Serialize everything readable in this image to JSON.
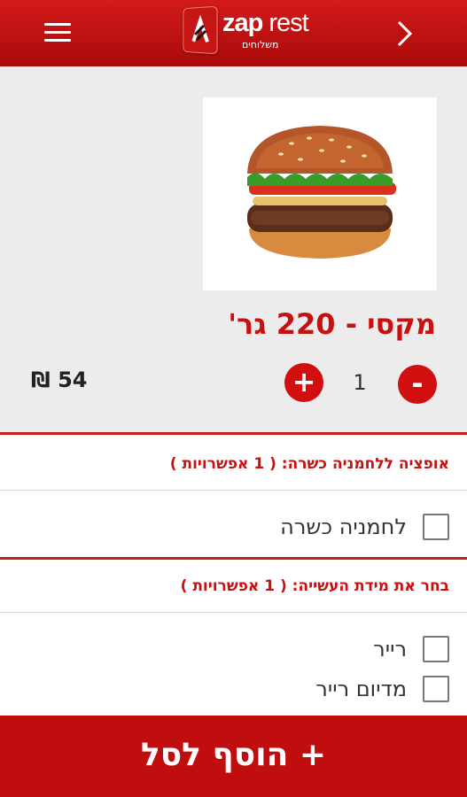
{
  "header": {
    "logo_main": "zap",
    "logo_second": " rest",
    "logo_sub": "משלוחים"
  },
  "product": {
    "title": "מקסי - 220 גר'",
    "quantity": "1",
    "minus_label": "-",
    "plus_label": "+",
    "price": "54 ₪"
  },
  "sections": [
    {
      "title": "אופציה ללחמניה כשרה: ( 1 אפשרויות )",
      "options": [
        {
          "label": "לחמניה כשרה",
          "checked": false
        }
      ]
    },
    {
      "title": "בחר את מידת העשייה: ( 1 אפשרויות )",
      "options": [
        {
          "label": "רייר",
          "checked": false
        },
        {
          "label": "מדיום רייר",
          "checked": false
        }
      ]
    }
  ],
  "add_to_cart": "+ הוסף לסל",
  "colors": {
    "brand_red": "#c71010",
    "header_top": "#d41a1a",
    "button_red": "#c00d0d"
  }
}
